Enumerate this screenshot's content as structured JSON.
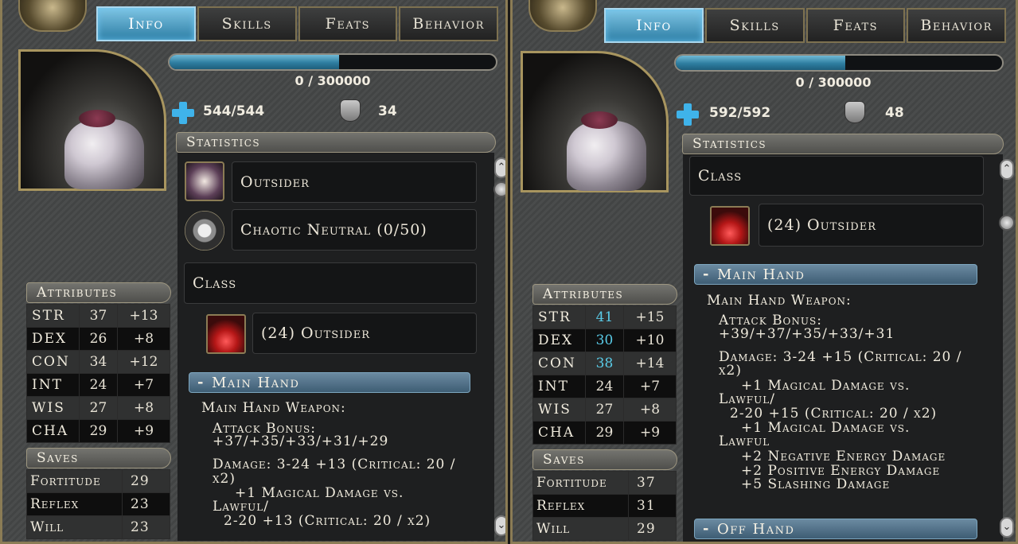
{
  "tabs": [
    "Info",
    "Skills",
    "Feats",
    "Behavior"
  ],
  "left": {
    "xp": "0 / 300000",
    "xp_fraction": 0.52,
    "hp": "544/544",
    "ac": "34",
    "statistics_label": "Statistics",
    "race": "Outsider",
    "alignment": "Chaotic Neutral (0/50)",
    "class_label": "Class",
    "class_entry": "(24) Outsider",
    "main_hand_header": "Main Hand",
    "weapon_lines": [
      "Main Hand Weapon:",
      "Attack Bonus:",
      "+37/+35/+33/+31/+29",
      "Damage: 3-24 +13 (Critical: 20 /",
      "x2)",
      "+1 Magical Damage vs.",
      "Lawful/",
      "2-20 +13 (Critical: 20 / x2)"
    ],
    "attributes_label": "Attributes",
    "attributes": [
      {
        "name": "STR",
        "value": "37",
        "mod": "+13"
      },
      {
        "name": "DEX",
        "value": "26",
        "mod": "+8"
      },
      {
        "name": "CON",
        "value": "34",
        "mod": "+12"
      },
      {
        "name": "INT",
        "value": "24",
        "mod": "+7"
      },
      {
        "name": "WIS",
        "value": "27",
        "mod": "+8"
      },
      {
        "name": "CHA",
        "value": "29",
        "mod": "+9"
      }
    ],
    "saves_label": "Saves",
    "saves": [
      {
        "name": "Fortitude",
        "value": "29"
      },
      {
        "name": "Reflex",
        "value": "23"
      },
      {
        "name": "Will",
        "value": "23"
      }
    ]
  },
  "right": {
    "xp": "0 / 300000",
    "xp_fraction": 0.52,
    "hp": "592/592",
    "ac": "48",
    "statistics_label": "Statistics",
    "class_label": "Class",
    "class_entry": "(24) Outsider",
    "main_hand_header": "Main Hand",
    "weapon_lines": [
      "Main Hand Weapon:",
      "Attack Bonus:",
      "+39/+37/+35/+33/+31",
      "Damage: 3-24 +15 (Critical: 20 /",
      "x2)",
      "+1 Magical Damage vs.",
      "Lawful/",
      "2-20 +15 (Critical: 20 / x2)",
      "+1 Magical Damage vs.",
      "Lawful",
      "+2 Negative Energy Damage",
      "+2 Positive Energy Damage",
      "+5 Slashing Damage"
    ],
    "off_hand_header": "Off Hand",
    "attributes_label": "Attributes",
    "attributes": [
      {
        "name": "STR",
        "value": "41",
        "mod": "+15"
      },
      {
        "name": "DEX",
        "value": "30",
        "mod": "+10"
      },
      {
        "name": "CON",
        "value": "38",
        "mod": "+14"
      },
      {
        "name": "INT",
        "value": "24",
        "mod": "+7"
      },
      {
        "name": "WIS",
        "value": "27",
        "mod": "+8"
      },
      {
        "name": "CHA",
        "value": "29",
        "mod": "+9"
      }
    ],
    "saves_label": "Saves",
    "saves": [
      {
        "name": "Fortitude",
        "value": "37"
      },
      {
        "name": "Reflex",
        "value": "31"
      },
      {
        "name": "Will",
        "value": "29"
      }
    ]
  },
  "colors": {
    "accent_blue": "#59cbe7",
    "gold_border": "#8b7c55",
    "tab_active": "#2d7ea5"
  },
  "icons": {
    "health": "health-cross-icon",
    "armor": "armor-class-icon",
    "race": "outsider-race-icon",
    "alignment": "alignment-icon",
    "class": "outsider-class-icon"
  }
}
